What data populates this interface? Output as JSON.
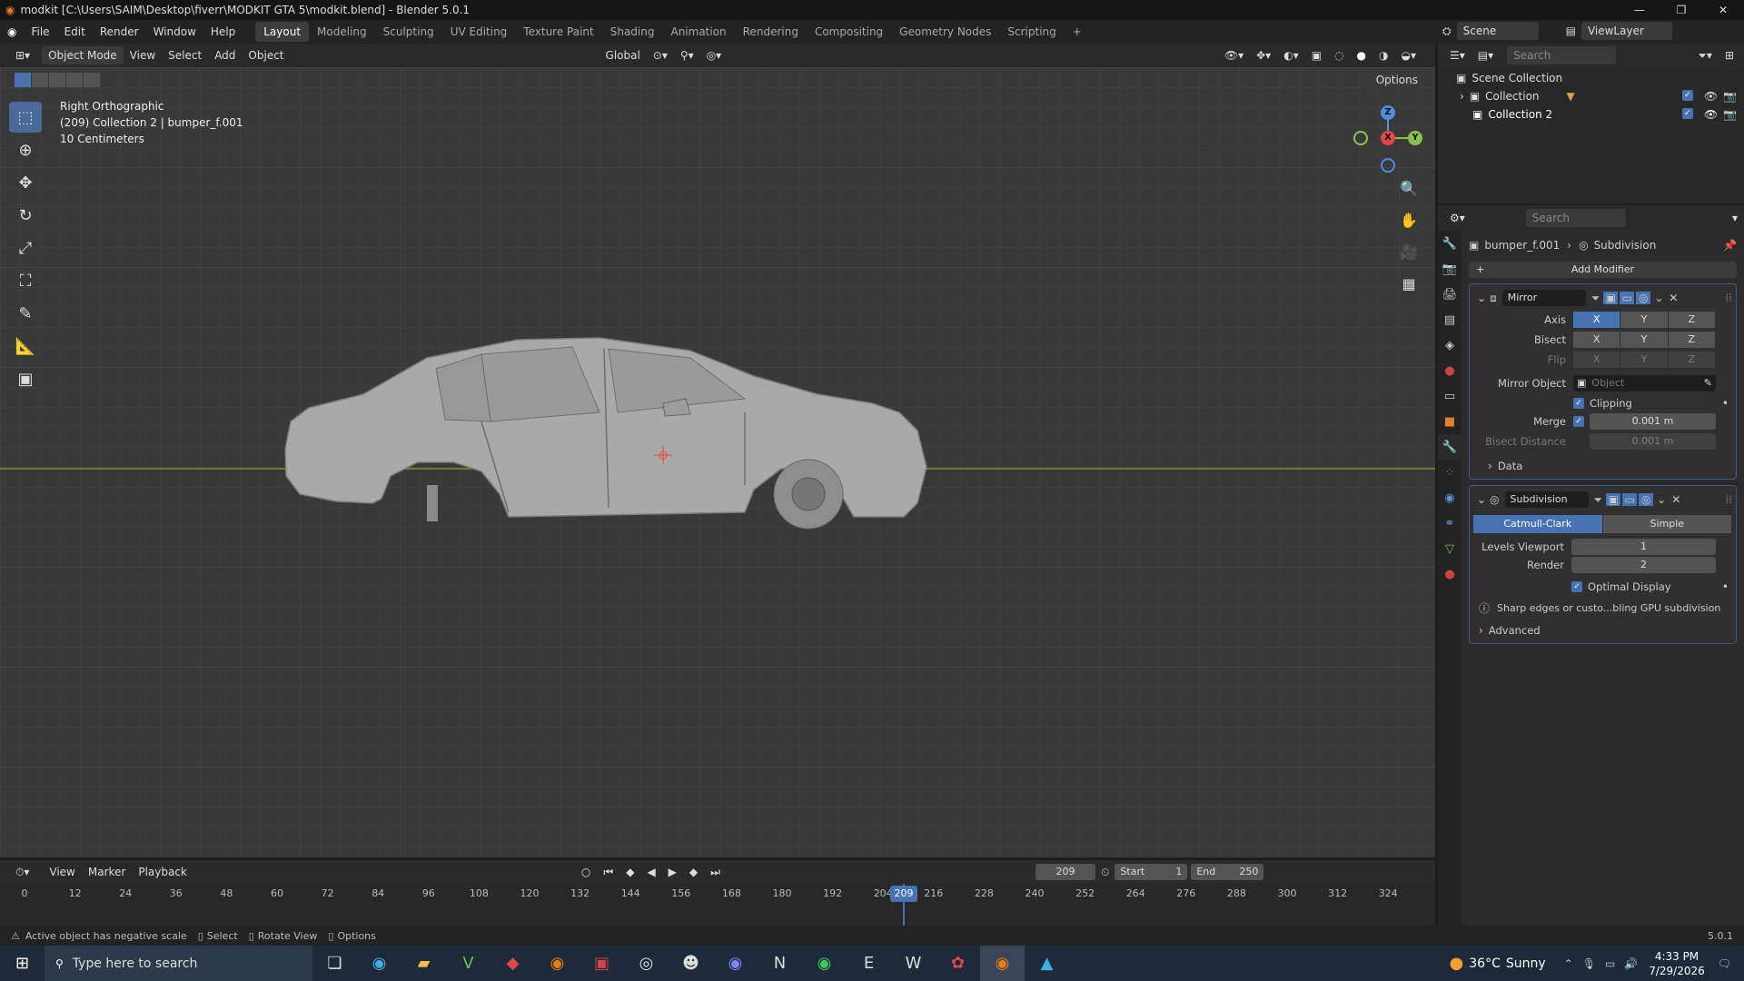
{
  "titlebar": {
    "title": "modkit [C:\\Users\\SAIM\\Desktop\\fiverr\\MODKIT GTA 5\\modkit.blend] - Blender 5.0.1"
  },
  "menu": {
    "items": [
      "File",
      "Edit",
      "Render",
      "Window",
      "Help"
    ]
  },
  "workspaces": [
    "Layout",
    "Modeling",
    "Sculpting",
    "UV Editing",
    "Texture Paint",
    "Shading",
    "Animation",
    "Rendering",
    "Compositing",
    "Geometry Nodes",
    "Scripting"
  ],
  "scene": {
    "name": "Scene",
    "view_layer": "ViewLayer"
  },
  "viewport_header": {
    "mode": "Object Mode",
    "view": "View",
    "select": "Select",
    "add": "Add",
    "object": "Object",
    "orientation": "Global",
    "options": "Options"
  },
  "viewport": {
    "info_line1": "Right Orthographic",
    "info_line2": "(209) Collection 2 | bumper_f.001",
    "info_line3": "10 Centimeters"
  },
  "gizmo": {
    "z": "Z",
    "x": "X",
    "y": "Y"
  },
  "outliner": {
    "search_placeholder": "Search",
    "scene_collection": "Scene Collection",
    "collections": [
      "Collection",
      "Collection 2"
    ]
  },
  "properties": {
    "search_placeholder": "Search",
    "object_name": "bumper_f.001",
    "modifier_breadcrumb": "Subdivision",
    "add_modifier": "Add Modifier",
    "mirror": {
      "name": "Mirror",
      "axis_label": "Axis",
      "bisect_label": "Bisect",
      "flip_label": "Flip",
      "axes": [
        "X",
        "Y",
        "Z"
      ],
      "mirror_object_label": "Mirror Object",
      "mirror_object_placeholder": "Object",
      "clipping_label": "Clipping",
      "merge_label": "Merge",
      "merge_value": "0.001 m",
      "bisect_distance_label": "Bisect Distance",
      "bisect_distance_value": "0.001 m",
      "data_label": "Data"
    },
    "subdivision": {
      "name": "Subdivision",
      "catmull": "Catmull-Clark",
      "simple": "Simple",
      "levels_viewport_label": "Levels Viewport",
      "levels_viewport_value": "1",
      "render_label": "Render",
      "render_value": "2",
      "optimal_display_label": "Optimal Display",
      "info_text": "Sharp edges or custo...bling GPU subdivision",
      "advanced_label": "Advanced"
    }
  },
  "timeline": {
    "view": "View",
    "marker": "Marker",
    "playback": "Playback",
    "current_frame": "209",
    "start_label": "Start",
    "start": "1",
    "end_label": "End",
    "end": "250",
    "ticks": [
      "0",
      "12",
      "24",
      "36",
      "48",
      "60",
      "72",
      "84",
      "96",
      "108",
      "120",
      "132",
      "144",
      "156",
      "168",
      "180",
      "192",
      "204",
      "216",
      "228",
      "240",
      "252",
      "264",
      "276",
      "288",
      "300",
      "312",
      "324"
    ]
  },
  "status": {
    "message": "Active object has negative scale",
    "select": "Select",
    "rotate": "Rotate View",
    "options": "Options",
    "version": "5.0.1"
  },
  "taskbar": {
    "search_placeholder": "Type here to search",
    "weather_temp": "36°C",
    "weather_text": "Sunny",
    "time": "4:33 PM",
    "date": "7/29/2026"
  }
}
